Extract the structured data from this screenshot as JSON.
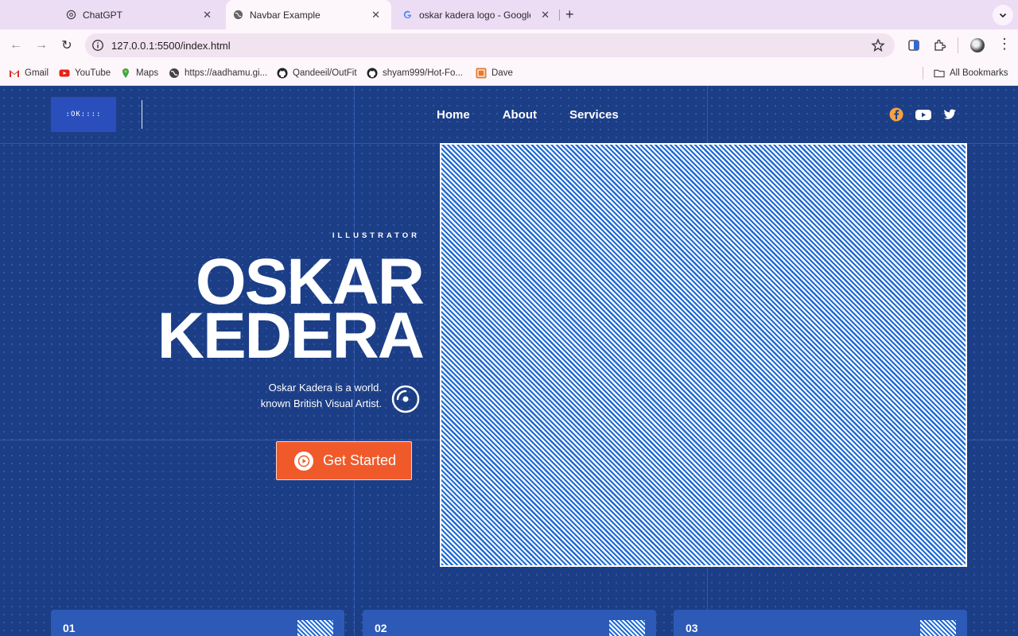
{
  "browser": {
    "tabs": [
      {
        "title": "ChatGPT",
        "icon": "openai-icon",
        "active": false
      },
      {
        "title": "Navbar Example",
        "icon": "globe-icon",
        "active": true
      },
      {
        "title": "oskar kadera logo - Google S",
        "icon": "google-icon",
        "active": false
      }
    ],
    "url": "127.0.0.1:5500/index.html",
    "bookmarks": [
      {
        "label": "Gmail",
        "icon": "gmail-icon"
      },
      {
        "label": "YouTube",
        "icon": "youtube-icon"
      },
      {
        "label": "Maps",
        "icon": "maps-icon"
      },
      {
        "label": "https://aadhamu.gi...",
        "icon": "globe-icon"
      },
      {
        "label": "Qandeeil/OutFit",
        "icon": "github-icon"
      },
      {
        "label": "shyam999/Hot-Fo...",
        "icon": "github-icon"
      },
      {
        "label": "Dave",
        "icon": "dave-icon"
      }
    ],
    "all_bookmarks": "All Bookmarks"
  },
  "site": {
    "logo_text": ":OK::::",
    "nav": [
      "Home",
      "About",
      "Services"
    ],
    "social": [
      "facebook-icon",
      "youtube-icon",
      "twitter-icon"
    ],
    "hero": {
      "eyebrow": "ILLUSTRATOR",
      "title_line1": "OSKAR",
      "title_line2": "KEDERA",
      "desc_line1": "Oskar Kadera is a world.",
      "desc_line2": "known British Visual Artist.",
      "cta": "Get Started"
    },
    "cards": [
      "01",
      "02",
      "03"
    ]
  },
  "colors": {
    "page_bg": "#1c3e86",
    "accent": "#f05a2b",
    "logo_bg": "#2a4ebc",
    "card_bg": "#2c5ab6",
    "facebook": "#f5a142"
  }
}
